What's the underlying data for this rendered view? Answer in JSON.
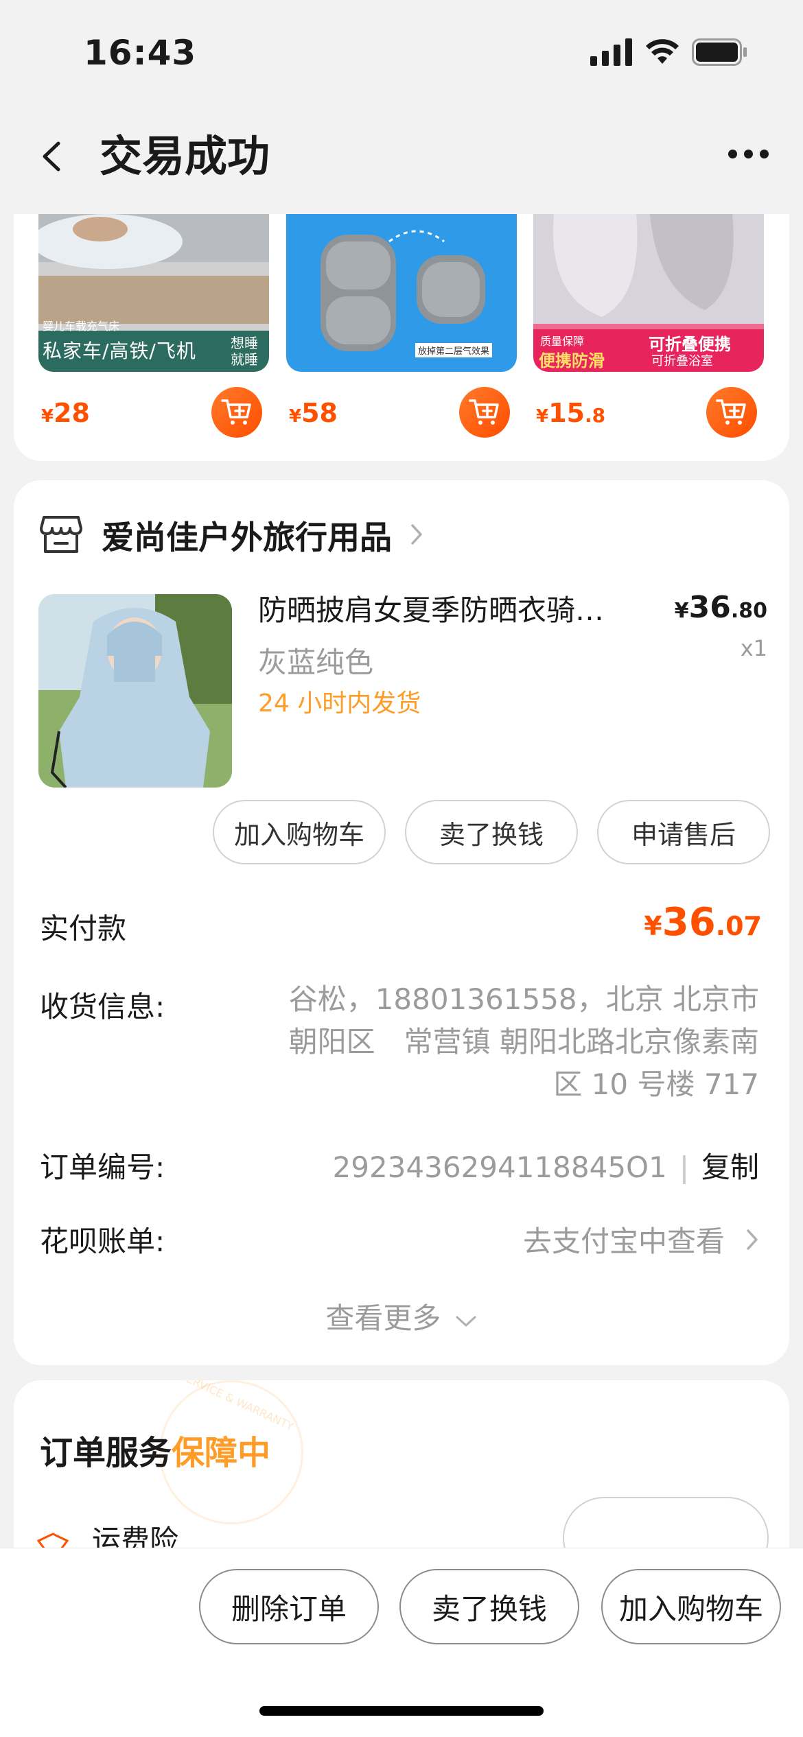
{
  "status_bar": {
    "time": "16:43"
  },
  "header": {
    "title": "交易成功"
  },
  "recommendations": [
    {
      "price_symbol": "¥",
      "price": "28",
      "decimal": "",
      "image_caption_small": "婴儿车载充气床",
      "image_caption": "私家车/高铁/飞机",
      "image_caption_side": "想睡 就睡"
    },
    {
      "price_symbol": "¥",
      "price": "58",
      "decimal": "",
      "image_caption_small": "放掉第二层气效果"
    },
    {
      "price_symbol": "¥",
      "price": "15",
      "decimal": ".8",
      "image_caption_left_small": "质量保障",
      "image_caption_left": "便携防滑",
      "image_caption_right": "可折叠便携",
      "image_caption_right_small": "可折叠浴室"
    }
  ],
  "order": {
    "shop_name": "爱尚佳户外旅行用品",
    "product": {
      "title": "防晒披肩女夏季防晒衣骑…",
      "spec": "灰蓝纯色",
      "shipping": "24 小时内发货",
      "price_symbol": "¥",
      "price_int": "36",
      "price_dec": ".80",
      "quantity": "x1"
    },
    "item_actions": [
      "加入购物车",
      "卖了换钱",
      "申请售后"
    ],
    "paid_label": "实付款",
    "paid_symbol": "¥",
    "paid_int": "36",
    "paid_dec": ".07",
    "address_label": "收货信息:",
    "address_line1": "谷松，18801361558，北京 北京市",
    "address_line2": "朝阳区　常营镇 朝阳北路北京像素南",
    "address_line3": "区 10 号楼 717",
    "order_no_label": "订单编号:",
    "order_no": "2923436294118845O1",
    "copy_label": "复制",
    "huabei_label": "花呗账单:",
    "huabei_value": "去支付宝中查看",
    "see_more": "查看更多"
  },
  "service": {
    "title_prefix": "订单服务",
    "title_highlight": "保障中",
    "stamp_text": "SERVICE & WARRANTY",
    "item_label": "运费险"
  },
  "bottom_actions": [
    "删除订单",
    "卖了换钱",
    "加入购物车"
  ],
  "colors": {
    "accent": "#ff5000",
    "orange": "#ff9c28",
    "gray_text": "#9b9b9b"
  }
}
